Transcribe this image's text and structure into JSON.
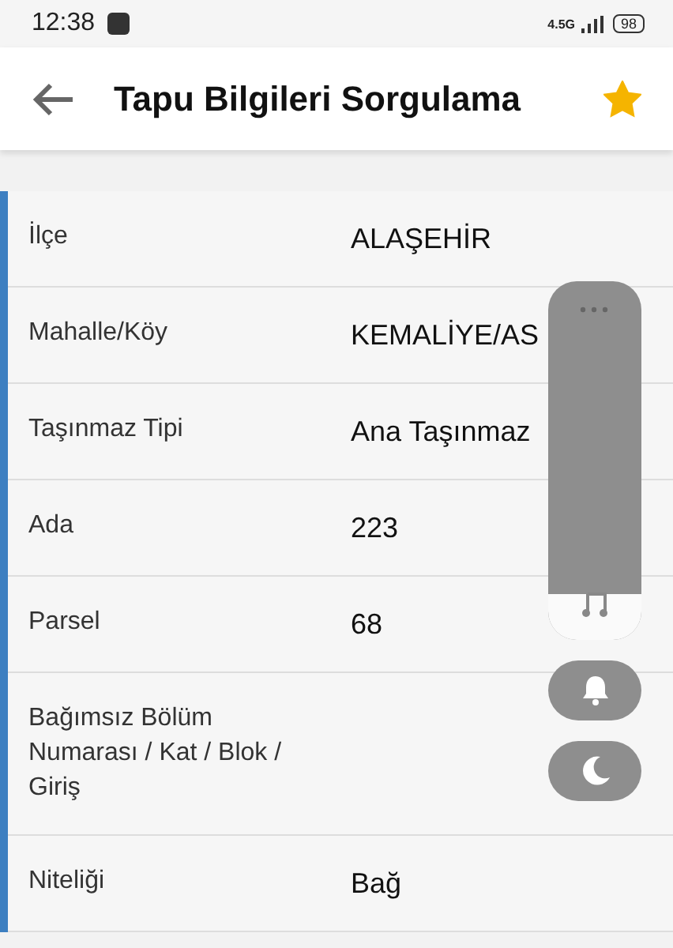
{
  "status_bar": {
    "time": "12:38",
    "network": "4.5G",
    "battery": "98"
  },
  "header": {
    "title": "Tapu Bilgileri Sorgulama",
    "favorite": true
  },
  "rows": [
    {
      "label": "İlçe",
      "value": "ALAŞEHİR"
    },
    {
      "label": "Mahalle/Köy",
      "value": "KEMALİYE/AS"
    },
    {
      "label": "Taşınmaz Tipi",
      "value": "Ana Taşınmaz"
    },
    {
      "label": "Ada",
      "value": "223"
    },
    {
      "label": "Parsel",
      "value": "68"
    },
    {
      "label": "Bağımsız Bölüm Numarası / Kat / Blok / Giriş"
    },
    {
      "label": "Niteliği",
      "value": "Bağ"
    }
  ],
  "volume_panel": {
    "level": 0.13
  }
}
